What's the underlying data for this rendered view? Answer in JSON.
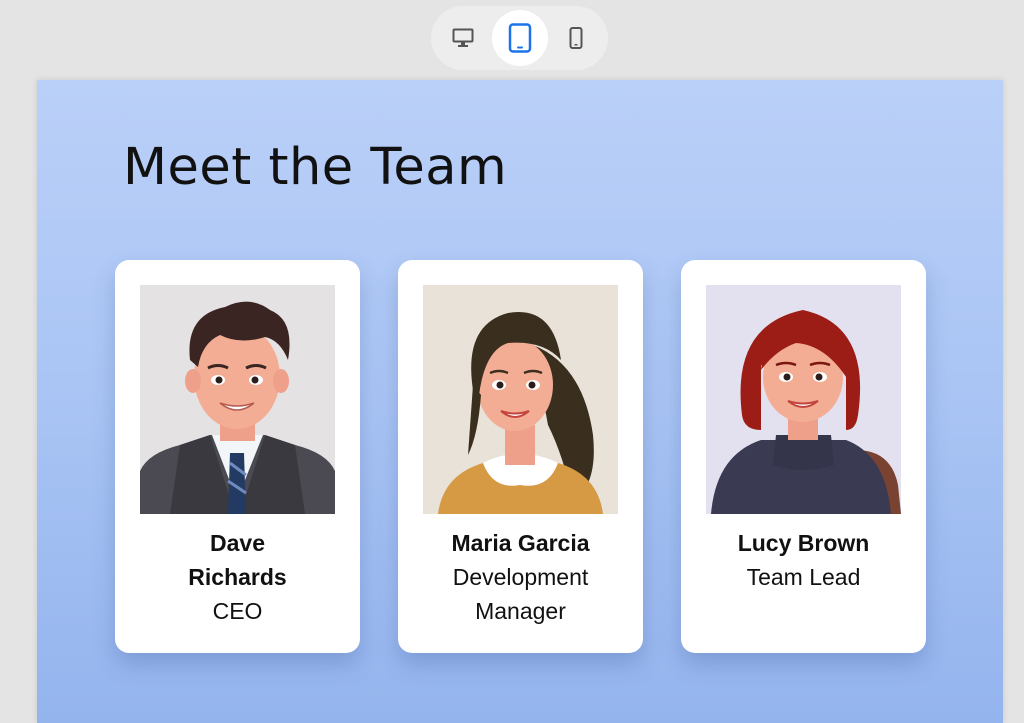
{
  "toolbar": {
    "devices": [
      {
        "icon": "desktop-icon",
        "active": false
      },
      {
        "icon": "tablet-icon",
        "active": true
      },
      {
        "icon": "mobile-icon",
        "active": false
      }
    ]
  },
  "section": {
    "title": "Meet the Team"
  },
  "team": [
    {
      "name": "Dave Richards",
      "role": "CEO"
    },
    {
      "name": "Maria Garcia",
      "role": "Development Manager"
    },
    {
      "name": "Lucy Brown",
      "role": "Team Lead"
    }
  ],
  "colors": {
    "accent": "#1a73e8",
    "canvas_top": "#bad0f8",
    "canvas_bottom": "#94b4ee"
  }
}
